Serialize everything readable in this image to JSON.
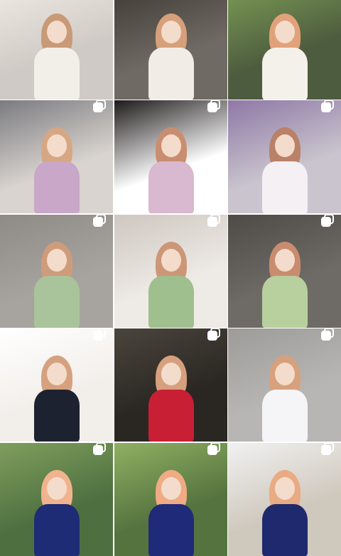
{
  "grid": {
    "tiles": [
      {
        "name": "post-1",
        "icon": "multiple-photos-icon",
        "bg": "#cfcac5",
        "accent": "#efe9e3",
        "hair": "#c99a78",
        "outfit": "#f2efe9"
      },
      {
        "name": "post-2",
        "icon": "multiple-photos-icon",
        "bg": "#6f6a63",
        "accent": "#3f3a35",
        "hair": "#d6a07a",
        "outfit": "#f1ede6"
      },
      {
        "name": "post-3",
        "icon": "multiple-photos-icon",
        "bg": "#4d5b3e",
        "accent": "#7a9a55",
        "hair": "#e1a27a",
        "outfit": "#f4f1ea"
      },
      {
        "name": "post-4",
        "icon": "multiple-photos-icon",
        "bg": "#d9d4cf",
        "accent": "#7b7b80",
        "hair": "#d6a783",
        "outfit": "#c9a7c8"
      },
      {
        "name": "post-5",
        "icon": "multiple-photos-icon",
        "bg": "#ffffff",
        "accent": "#1e1a1a",
        "hair": "#c98e6f",
        "outfit": "#d9b9cf"
      },
      {
        "name": "post-6",
        "icon": "multiple-photos-icon",
        "bg": "#c9c4cd",
        "accent": "#8f78a6",
        "hair": "#b98168",
        "outfit": "#f4f0f3"
      },
      {
        "name": "post-7",
        "icon": "multiple-photos-icon",
        "bg": "#a7a39f",
        "accent": "#8e8a86",
        "hair": "#cf9c7b",
        "outfit": "#a9c49a"
      },
      {
        "name": "post-8",
        "icon": "multiple-photos-icon",
        "bg": "#eeeae6",
        "accent": "#cfc7c0",
        "hair": "#cc9777",
        "outfit": "#9fbf8e"
      },
      {
        "name": "post-9",
        "icon": "multiple-photos-icon",
        "bg": "#6e6b67",
        "accent": "#4e4b47",
        "hair": "#c98c6f",
        "outfit": "#b8cf9e"
      },
      {
        "name": "post-10",
        "icon": "multiple-photos-icon",
        "bg": "#f2eeea",
        "accent": "#ffffff",
        "hair": "#d5a17e",
        "outfit": "#1d2230"
      },
      {
        "name": "post-11",
        "icon": "multiple-photos-icon",
        "bg": "#2a2622",
        "accent": "#4a453c",
        "hair": "#d6a07e",
        "outfit": "#c81f35"
      },
      {
        "name": "post-12",
        "icon": "multiple-photos-icon",
        "bg": "#b7b6b4",
        "accent": "#9e9c99",
        "hair": "#d7a17d",
        "outfit": "#f5f5f7"
      },
      {
        "name": "post-13",
        "icon": "multiple-photos-icon",
        "bg": "#4e7040",
        "accent": "#7f9e5d",
        "hair": "#f0b38d",
        "outfit": "#1e2b75"
      },
      {
        "name": "post-14",
        "icon": "multiple-photos-icon",
        "bg": "#55733f",
        "accent": "#8fb063",
        "hair": "#f0ab84",
        "outfit": "#1f2a79"
      },
      {
        "name": "post-15",
        "icon": "multiple-photos-icon",
        "bg": "#cfc8bd",
        "accent": "#f1f1f1",
        "hair": "#e8ab84",
        "outfit": "#1e2a6d"
      }
    ]
  }
}
